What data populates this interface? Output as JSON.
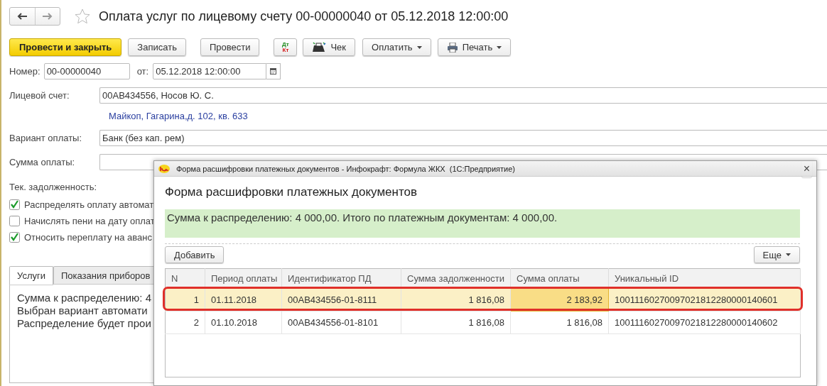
{
  "document": {
    "title": "Оплата услуг по лицевому счету 00-00000040 от 05.12.2018 12:00:00",
    "favorite": false
  },
  "toolbar": [
    {
      "kind": "primary",
      "label": "Провести и закрыть"
    },
    {
      "kind": "plain",
      "label": "Записать"
    },
    {
      "kind": "plain",
      "label": "Провести"
    },
    {
      "kind": "dtkt",
      "dt": "Дт",
      "kt": "Кт"
    },
    {
      "kind": "register",
      "label": "Чек"
    },
    {
      "kind": "menu",
      "label": "Оплатить"
    },
    {
      "kind": "print-menu",
      "label": "Печать"
    }
  ],
  "number": {
    "label": "Номер:",
    "value": "00-00000040"
  },
  "date": {
    "label": "от:",
    "value": "05.12.2018 12:00:00"
  },
  "fields": [
    {
      "label": "Лицевой счет:",
      "value": "00АВ434556, Носов Ю. С.",
      "link": "Майкоп, Гагарина,д. 102, кв. 633"
    },
    {
      "label": "Вариант оплаты:",
      "value": "Банк (без кап. рем)"
    },
    {
      "label": "Сумма оплаты:"
    }
  ],
  "debt_label": "Тек. задолженность:",
  "checkboxes": [
    {
      "label": "Распределять оплату автомат",
      "checked": true
    },
    {
      "label": "Начислять пени на дату оплат",
      "checked": false
    },
    {
      "label": "Относить переплату на аванс",
      "checked": true
    }
  ],
  "tabs": [
    {
      "label": "Услуги",
      "selected": true
    },
    {
      "label": "Показания приборов",
      "selected": false
    }
  ],
  "tab_text": [
    "Сумма к распределению: 4",
    "Выбран вариант автомати",
    "Распределение будет прои"
  ],
  "dialog": {
    "window_title": "Форма расшифровки платежных документов - Инфокрафт: Формула ЖКХ  (1С:Предприятие)",
    "close": "×",
    "heading": "Форма расшифровки платежных документов",
    "summary": "Сумма к распределению: 4 000,00. Итого по платежным документам: 4 000,00.",
    "add_button": "Добавить",
    "more_button": "Еще",
    "table": {
      "columns": [
        "N",
        "Период оплаты",
        "Идентификатор ПД",
        "Сумма задолженности",
        "Сумма оплаты",
        "Уникальный ID"
      ],
      "rows": [
        {
          "cells": [
            "1",
            "01.11.2018",
            "00АВ434556-01-8111",
            "1 816,08",
            "2 183,92",
            "10011160270097021812280000140601"
          ],
          "selected": true,
          "highlighted": true
        },
        {
          "cells": [
            "2",
            "01.10.2018",
            "00АВ434556-01-8101",
            "1 816,08",
            "1 816,08",
            "10011160270097021812280000140602"
          ],
          "selected": false,
          "highlighted": false
        }
      ]
    }
  }
}
